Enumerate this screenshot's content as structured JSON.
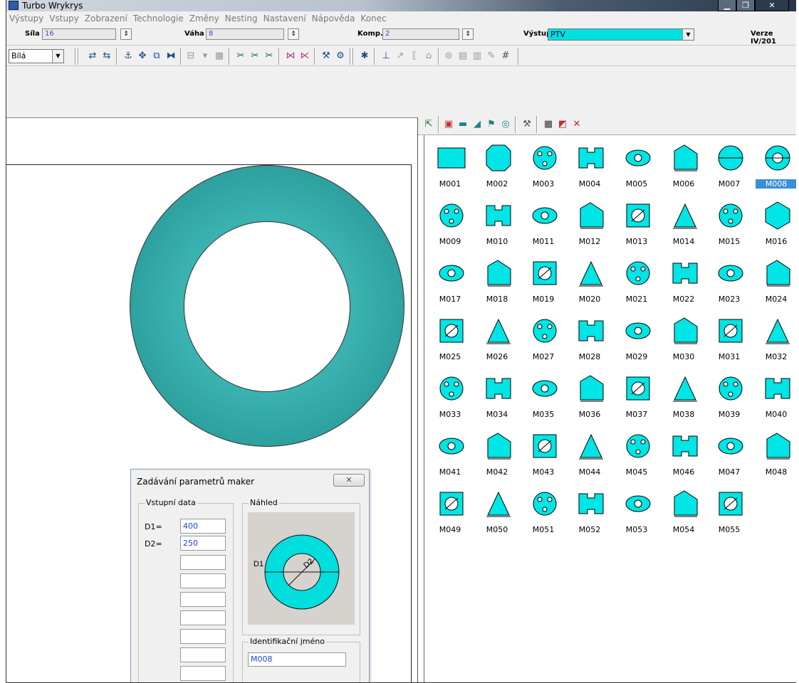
{
  "window": {
    "title": "Turbo Wrykrys"
  },
  "menu": [
    "Výstupy",
    "Vstupy",
    "Zobrazení",
    "Technologie",
    "Změny",
    "Nesting",
    "Nastavení",
    "Nápověda",
    "Konec"
  ],
  "params": {
    "sila_label": "Síla",
    "sila_value": "16",
    "vaha_label": "Váha",
    "vaha_value": "8",
    "komp_label": "Komp.",
    "komp_value": "2",
    "vystup_label": "Výstup",
    "vystup_value": "PTV",
    "verze": "Verze IV/201"
  },
  "toolbar": {
    "color_select": "Bílá"
  },
  "dialog": {
    "title": "Zadávání parametrů maker",
    "close": "✕",
    "input_legend": "Vstupní data",
    "preview_legend": "Náhled",
    "d1_label": "D1=",
    "d1_value": "400",
    "d2_label": "D2=",
    "d2_value": "250",
    "id_legend": "Identifikační jméno",
    "id_value": "M008",
    "preview_d1": "D1",
    "preview_d2": "D2"
  },
  "macros": [
    "M001",
    "M002",
    "M003",
    "M004",
    "M005",
    "M006",
    "M007",
    "M008",
    "M009",
    "M010",
    "M011",
    "M012",
    "M013",
    "M014",
    "M015",
    "M016",
    "M017",
    "M018",
    "M019",
    "M020",
    "M021",
    "M022",
    "M023",
    "M024",
    "M025",
    "M026",
    "M027",
    "M028",
    "M029",
    "M030",
    "M031",
    "M032",
    "M033",
    "M034",
    "M035",
    "M036",
    "M037",
    "M038",
    "M039",
    "M040",
    "M041",
    "M042",
    "M043",
    "M044",
    "M045",
    "M046",
    "M047",
    "M048",
    "M049",
    "M050",
    "M051",
    "M052",
    "M053",
    "M054",
    "M055"
  ],
  "selected_macro": "M008",
  "colors": {
    "shape_fill": "#00e5e5",
    "ring_fill": "#2aa6a6",
    "selection": "#3a8fd8"
  }
}
